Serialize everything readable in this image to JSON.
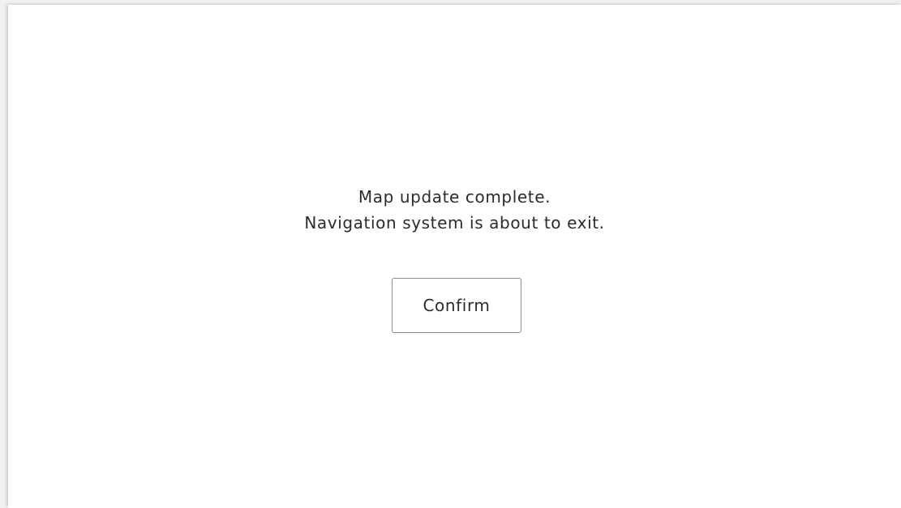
{
  "dialog": {
    "message_line1": "Map update complete.",
    "message_line2": "Navigation system is about to exit.",
    "confirm_label": "Confirm"
  }
}
